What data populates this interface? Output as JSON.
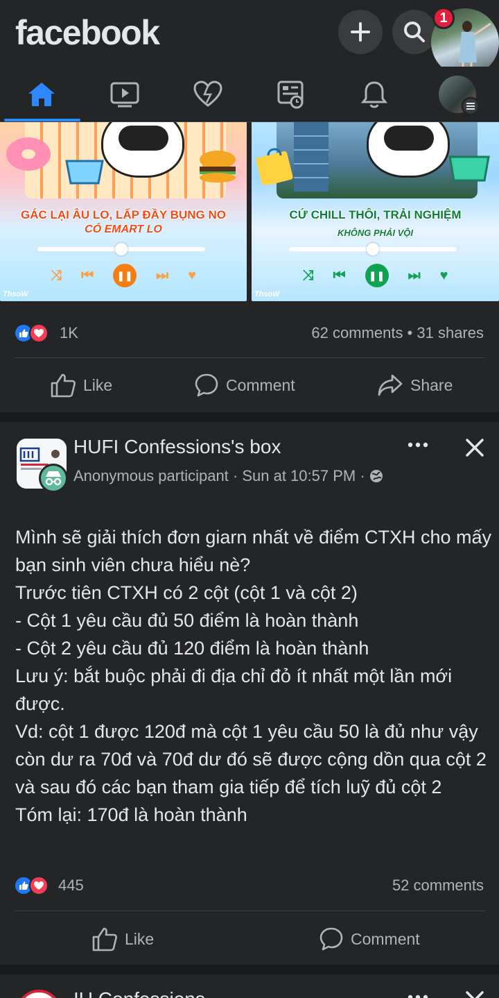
{
  "app": {
    "logo": "facebook",
    "notification_count": "1"
  },
  "nav": {
    "items": [
      "home",
      "watch",
      "dating",
      "feeds",
      "notifications",
      "menu"
    ],
    "active": "home",
    "accent_color": "#2d88ff"
  },
  "post1": {
    "promo_left": {
      "line1": "GÁC LẠI ÂU LO, LẤP ĐẦY BỤNG NO",
      "line2": "CÓ EMART LO",
      "watermark": "Thso​W",
      "accent": "#f44a17"
    },
    "promo_right": {
      "line1": "CỨ CHILL THÔI, TRẢI NGHIỆM",
      "line2": "KHÔNG PHẢI VỘI",
      "watermark": "Thso​W",
      "accent": "#0d7f3a"
    },
    "reaction_count": "1K",
    "comments_shares": "62 comments • 31 shares",
    "actions": {
      "like": "Like",
      "comment": "Comment",
      "share": "Share"
    }
  },
  "post2": {
    "author": "HUFI Confessions's box",
    "meta": "Anonymous participant · Sun at 10:57 PM · ",
    "body": "Mình sẽ giải thích đơn giarn nhất về điểm CTXH cho mấy bạn sinh viên chưa hiểu nè?\nTrước tiên CTXH có 2 cột (cột 1 và cột 2)\n- Cột 1 yêu cầu đủ 50 điểm là hoàn thành\n- Cột 2 yêu cầu đủ 120 điểm là hoàn thành\nLưu ý: bắt buộc phải đi địa chỉ đỏ ít nhất một lần mới được.\nVd: cột 1 được 120đ mà cột 1 yêu cầu 50 là  đủ như vậy còn dư ra 70đ và 70đ dư đó sẽ được cộng dồn qua cột 2 và sau đó các bạn tham gia tiếp để tích luỹ đủ cột 2\nTóm lại: 170đ là hoàn thành",
    "reaction_count": "445",
    "comments": "52 comments",
    "actions": {
      "like": "Like",
      "comment": "Comment"
    }
  },
  "post3": {
    "author": "IU Confessions"
  }
}
